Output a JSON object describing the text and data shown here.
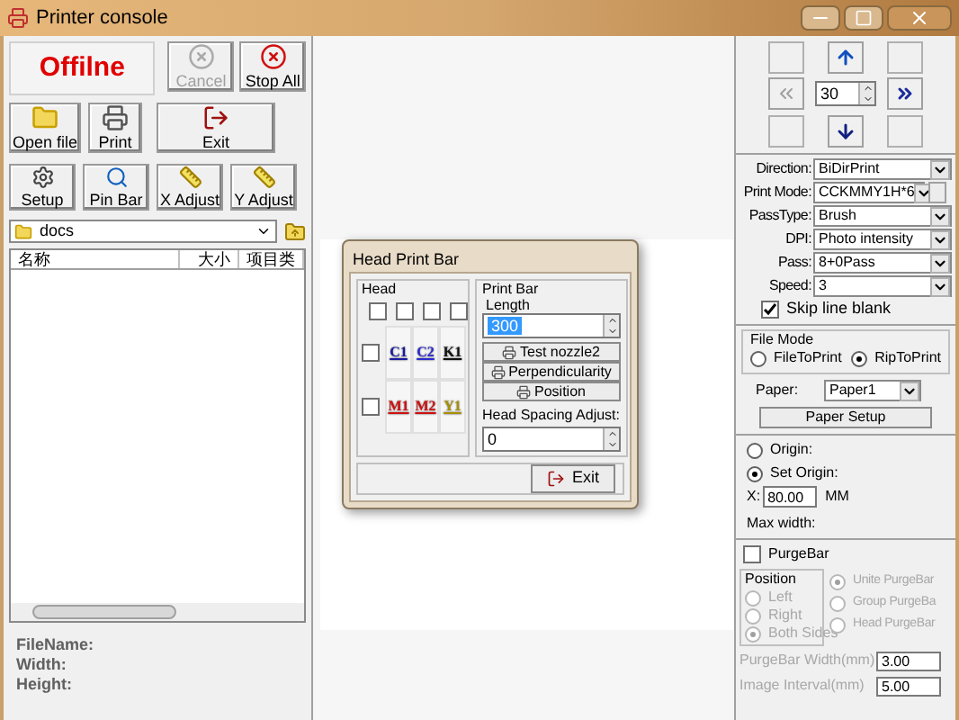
{
  "window": {
    "title": "Printer console"
  },
  "status": {
    "text": "Offilne"
  },
  "toolbar": [
    {
      "label": "Cancel",
      "disabled": true
    },
    {
      "label": "Stop All",
      "disabled": false
    },
    {
      "label": "Open file",
      "disabled": false
    },
    {
      "label": "Print",
      "disabled": false
    },
    {
      "label": "Exit",
      "disabled": false
    },
    {
      "label": "Setup",
      "disabled": false
    },
    {
      "label": "Pin Bar",
      "disabled": false
    },
    {
      "label": "X Adjust",
      "disabled": false
    },
    {
      "label": "Y Adjust",
      "disabled": false
    }
  ],
  "folder": {
    "value": "docs"
  },
  "file_list": {
    "columns": [
      "名称",
      "大小",
      "项目类"
    ]
  },
  "file_info": [
    "FileName:",
    "Width:",
    "Height:"
  ],
  "dialog": {
    "title": "Head Print Bar",
    "head_group": "Head",
    "top_checks": [
      {
        "checked": false
      },
      {
        "checked": false
      },
      {
        "checked": false
      },
      {
        "checked": false
      }
    ],
    "rows": [
      {
        "checked": false,
        "heads": [
          {
            "label": "C1",
            "color": "#1a1aa0"
          },
          {
            "label": "C2",
            "color": "#2a2ad0"
          },
          {
            "label": "K1",
            "color": "#111111"
          }
        ]
      },
      {
        "checked": false,
        "heads": [
          {
            "label": "M1",
            "color": "#d01010"
          },
          {
            "label": "M2",
            "color": "#d01010"
          },
          {
            "label": "Y1",
            "color": "#a89000"
          }
        ]
      }
    ],
    "print_bar": {
      "title": "Print Bar",
      "length_label": "Length",
      "length_value": "300",
      "buttons": [
        "Test nozzle2",
        "Perpendicularity",
        "Position"
      ],
      "spacing_label": "Head Spacing Adjust:",
      "spacing_value": "0"
    },
    "exit": "Exit"
  },
  "move_pad": {
    "step": "30",
    "back_disabled": true
  },
  "settings": [
    {
      "label": "Direction:",
      "value": "BiDirPrint",
      "kind": "combo"
    },
    {
      "label": "Print Mode:",
      "value": "CCKMMY1H*6",
      "kind": "combo_button"
    },
    {
      "label": "PassType:",
      "value": "Brush",
      "kind": "combo"
    },
    {
      "label": "DPI:",
      "value": "Photo intensity",
      "kind": "combo"
    },
    {
      "label": "Pass:",
      "value": "8+0Pass",
      "kind": "combo"
    },
    {
      "label": "Speed:",
      "value": "3",
      "kind": "combo"
    }
  ],
  "skip_blank": {
    "label": "Skip line blank",
    "checked": true
  },
  "file_mode": {
    "title": "File Mode",
    "options": [
      {
        "label": "FileToPrint",
        "selected": false
      },
      {
        "label": "RipToPrint",
        "selected": true
      }
    ]
  },
  "paper": {
    "label": "Paper:",
    "value": "Paper1"
  },
  "paper_setup": "Paper Setup",
  "origin": {
    "options": [
      {
        "label": "Origin:",
        "selected": false
      },
      {
        "label": "Set Origin:",
        "selected": true
      }
    ],
    "x_label": "X:",
    "x_value": "80.00",
    "unit": "MM",
    "max_width": "Max width:"
  },
  "purge": {
    "label": "PurgeBar",
    "checked": false,
    "disabled": true,
    "position_title": "Position",
    "positions": [
      {
        "label": "Left",
        "selected": false
      },
      {
        "label": "Right",
        "selected": false
      },
      {
        "label": "Both Sides",
        "selected": true
      }
    ],
    "modes": [
      {
        "label": "Unite PurgeBar",
        "selected": true
      },
      {
        "label": "Group PurgeBa",
        "selected": false
      },
      {
        "label": "Head PurgeBar",
        "selected": false
      }
    ],
    "fields": [
      {
        "label": "PurgeBar Width(mm)",
        "value": "3.00"
      },
      {
        "label": "Image Interval(mm)",
        "value": "5.00"
      }
    ]
  }
}
